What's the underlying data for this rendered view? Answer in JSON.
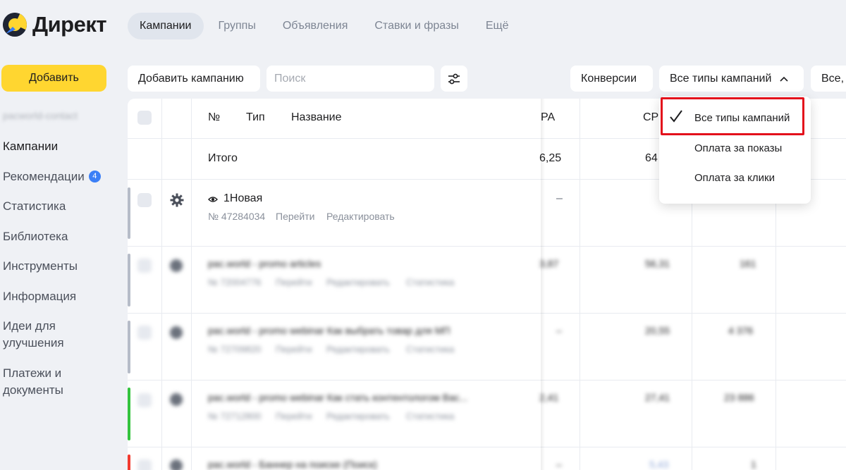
{
  "app": {
    "logo_text": "Директ",
    "brand_color": "#ffd630",
    "accent_color": "#3b7ff6"
  },
  "topnav": {
    "tabs": [
      {
        "label": "Кампании",
        "active": true
      },
      {
        "label": "Группы"
      },
      {
        "label": "Объявления"
      },
      {
        "label": "Ставки и фразы"
      },
      {
        "label": "Ещё"
      }
    ]
  },
  "sidebar": {
    "add_label": "Добавить",
    "account_label": "pacworld-contact",
    "items": [
      {
        "label": "Кампании",
        "active": true
      },
      {
        "label": "Рекомендации",
        "badge": "4"
      },
      {
        "label": "Статистика"
      },
      {
        "label": "Библиотека"
      },
      {
        "label": "Инструменты"
      },
      {
        "label": "Информация"
      },
      {
        "label": "Идеи для улучшения"
      },
      {
        "label": "Платежи и документы"
      }
    ]
  },
  "toolbar": {
    "add_campaign": "Добавить кампанию",
    "search_placeholder": "Поиск",
    "filter_icon": "sliders-icon",
    "conversions": "Конверсии",
    "campaign_types": "Все типы кампаний",
    "status_filter": "Все,"
  },
  "table": {
    "headers": {
      "number": "№",
      "type": "Тип",
      "name": "Название",
      "cpa": "PA",
      "cpc": "CP"
    },
    "totals": {
      "label": "Итого",
      "cpa": "6,25",
      "cpc": "64"
    },
    "rows": [
      {
        "name": "1Новая",
        "id": "№ 47284034",
        "go": "Перейти",
        "edit": "Редактировать",
        "cpa": "–",
        "bar_color": "#b6bcc8"
      },
      {
        "name": "pac.world - promo articles",
        "id": "№ 72004776",
        "go": "Перейти",
        "edit": "Редактировать",
        "stats": "Статистика",
        "cpa": "3,87",
        "cpc": "56,31",
        "extra": "161",
        "bar_color": "#b6bcc8"
      },
      {
        "name": "pac.world - promo webinar Как выбрать товар для МП",
        "id": "№ 72709820",
        "go": "Перейти",
        "edit": "Редактировать",
        "stats": "Статистика",
        "cpa": "–",
        "cpc": "20,55",
        "extra": "4 376",
        "bar_color": "#b6bcc8"
      },
      {
        "name": "pac.world - promo webinar Как стать контентологом Вас...",
        "id": "№ 72712800",
        "go": "Перейти",
        "edit": "Редактировать",
        "stats": "Статистика",
        "cpa": "2,41",
        "cpc": "27,41",
        "extra": "23 886",
        "bar_color": "#33c33d"
      },
      {
        "name": "pac.world - Баннер на поиске (Поиск)",
        "cpa": "–",
        "cpc": "5,43",
        "extra": "1",
        "bar_color": "#f23a2f"
      }
    ]
  },
  "dropdown": {
    "items": [
      {
        "label": "Все типы кампаний",
        "selected": true
      },
      {
        "label": "Оплата за показы"
      },
      {
        "label": "Оплата за клики"
      }
    ],
    "highlight_color": "#e3101b"
  }
}
